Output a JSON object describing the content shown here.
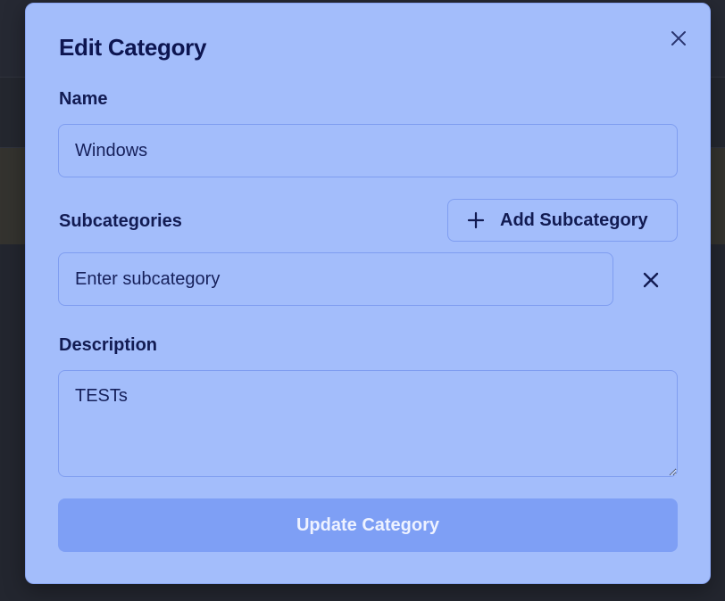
{
  "modal": {
    "title": "Edit Category",
    "close_icon": "close-icon",
    "name": {
      "label": "Name",
      "value": "Windows"
    },
    "subcategories": {
      "label": "Subcategories",
      "add_button_label": "Add Subcategory",
      "add_icon": "plus-icon",
      "items": [
        {
          "value": "",
          "placeholder": "Enter subcategory",
          "remove_icon": "x-icon"
        }
      ]
    },
    "description": {
      "label": "Description",
      "value": "TESTs"
    },
    "submit_label": "Update Category"
  },
  "colors": {
    "modal_bg": "#a3bdfb",
    "border": "#7f9df0",
    "text": "#121b52",
    "button_bg": "#7e9ff5",
    "button_text": "#eef2ff",
    "backdrop": "#23262f"
  }
}
